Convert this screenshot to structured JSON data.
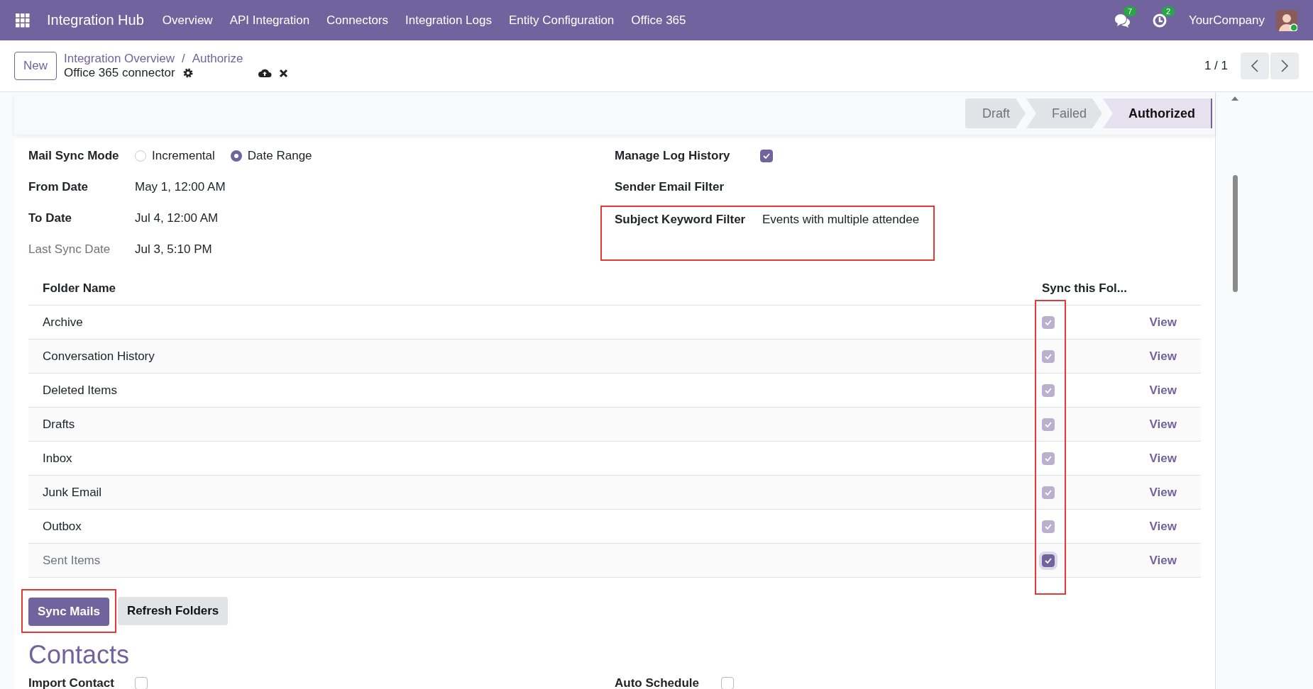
{
  "navbar": {
    "app_name": "Integration Hub",
    "menu": [
      "Overview",
      "API Integration",
      "Connectors",
      "Integration Logs",
      "Entity Configuration",
      "Office 365"
    ],
    "messages_count": "7",
    "activities_count": "2",
    "company": "YourCompany"
  },
  "control_panel": {
    "new_button": "New",
    "breadcrumbs": [
      "Integration Overview",
      "Authorize"
    ],
    "breadcrumb_separator": "/",
    "record_title": "Office 365 connector",
    "pager": "1 / 1"
  },
  "statusbar": [
    {
      "label": "Draft",
      "selected": false
    },
    {
      "label": "Failed",
      "selected": false
    },
    {
      "label": "Authorized",
      "selected": true
    }
  ],
  "form": {
    "mail_sync_mode": {
      "label": "Mail Sync Mode",
      "options": [
        {
          "label": "Incremental",
          "selected": false
        },
        {
          "label": "Date Range",
          "selected": true
        }
      ]
    },
    "left_fields": [
      {
        "label": "From Date",
        "value": "May 1, 12:00 AM",
        "readonly": false
      },
      {
        "label": "To Date",
        "value": "Jul 4, 12:00 AM",
        "readonly": false
      },
      {
        "label": "Last Sync Date",
        "value": "Jul 3, 5:10 PM",
        "readonly": true
      }
    ],
    "manage_log_history": {
      "label": "Manage Log History",
      "checked": true
    },
    "sender_email_filter": {
      "label": "Sender Email Filter"
    },
    "subject_keyword_filter": {
      "label": "Subject Keyword Filter",
      "value": "Events with multiple attendee"
    }
  },
  "folders": {
    "columns": [
      "Folder Name",
      "Sync this Fol..."
    ],
    "rows": [
      {
        "name": "Archive",
        "sync": true,
        "editing": false,
        "action": "View"
      },
      {
        "name": "Conversation History",
        "sync": true,
        "editing": false,
        "action": "View"
      },
      {
        "name": "Deleted Items",
        "sync": true,
        "editing": false,
        "action": "View"
      },
      {
        "name": "Drafts",
        "sync": true,
        "editing": false,
        "action": "View"
      },
      {
        "name": "Inbox",
        "sync": true,
        "editing": false,
        "action": "View"
      },
      {
        "name": "Junk Email",
        "sync": true,
        "editing": false,
        "action": "View"
      },
      {
        "name": "Outbox",
        "sync": true,
        "editing": false,
        "action": "View"
      },
      {
        "name": "Sent Items",
        "sync": true,
        "editing": true,
        "action": "View"
      }
    ]
  },
  "buttons": [
    {
      "label": "Sync Mails",
      "kind": "primary"
    },
    {
      "label": "Refresh Folders",
      "kind": "secondary"
    }
  ],
  "contacts": {
    "title": "Contacts",
    "fields": [
      {
        "label": "Import Contact",
        "checked": false
      },
      {
        "label": "Auto Schedule",
        "checked": false
      }
    ]
  }
}
